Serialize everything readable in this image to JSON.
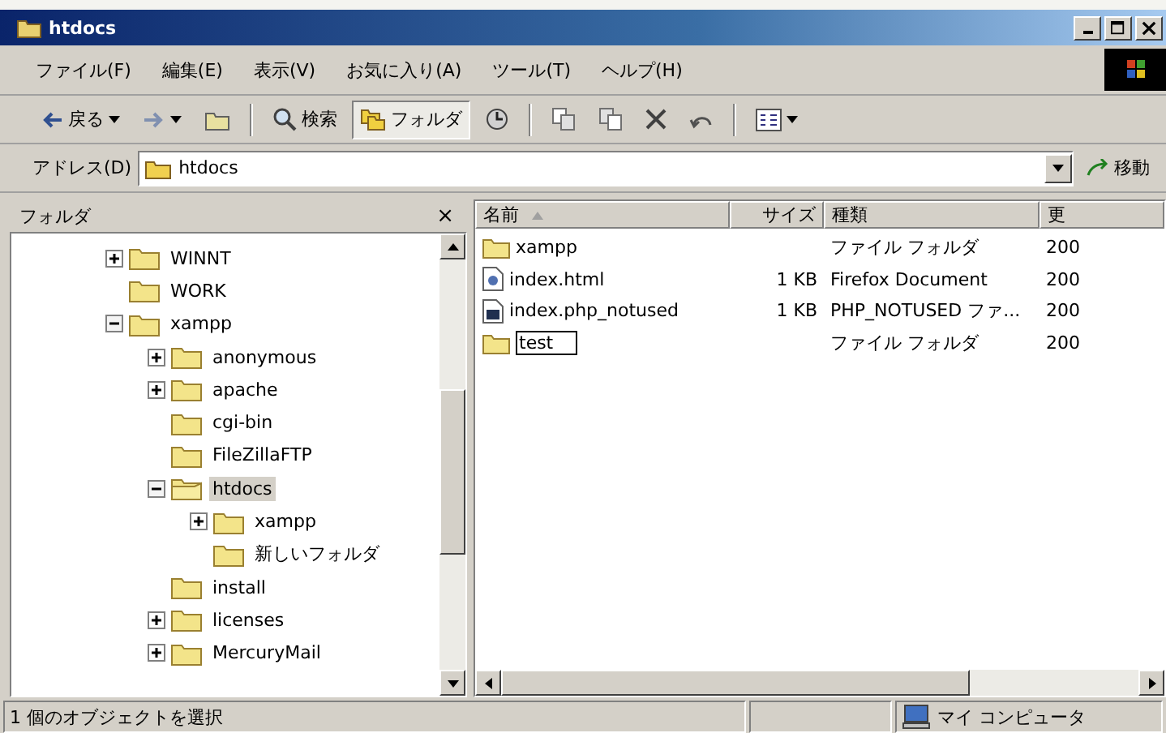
{
  "window": {
    "title": "htdocs"
  },
  "menu": [
    "ファイル(F)",
    "編集(E)",
    "表示(V)",
    "お気に入り(A)",
    "ツール(T)",
    "ヘルプ(H)"
  ],
  "toolbar": [
    {
      "kind": "back",
      "label": "戻る",
      "selected": false
    },
    {
      "kind": "forward",
      "selected": false
    },
    {
      "kind": "up",
      "selected": false
    },
    {
      "kind": "search",
      "label": "検索",
      "selected": false
    },
    {
      "kind": "folders",
      "label": "フォルダ",
      "selected": true
    },
    {
      "kind": "history",
      "selected": false
    },
    {
      "kind": "move",
      "selected": false
    },
    {
      "kind": "copy",
      "selected": false
    },
    {
      "kind": "delete",
      "selected": false
    },
    {
      "kind": "undo",
      "selected": false
    },
    {
      "kind": "views",
      "selected": false
    }
  ],
  "address": {
    "label": "アドレス(D)",
    "value": "htdocs",
    "go": "移動"
  },
  "folder_pane": {
    "title": "フォルダ",
    "close": "×"
  },
  "tree": [
    {
      "name": "WINNT",
      "kind": "branch",
      "expanded": false,
      "selected": false
    },
    {
      "name": "WORK",
      "kind": "leaf",
      "selected": false
    },
    {
      "name": "xampp",
      "kind": "branch",
      "expanded": true,
      "selected": false,
      "children": [
        {
          "name": "anonymous",
          "kind": "branch",
          "expanded": false,
          "selected": false
        },
        {
          "name": "apache",
          "kind": "branch",
          "expanded": false,
          "selected": false
        },
        {
          "name": "cgi-bin",
          "kind": "leaf",
          "selected": false
        },
        {
          "name": "FileZillaFTP",
          "kind": "leaf",
          "selected": false
        },
        {
          "name": "htdocs",
          "kind": "branch",
          "expanded": true,
          "selected": true,
          "children": [
            {
              "name": "xampp",
              "kind": "branch",
              "expanded": false,
              "selected": false
            },
            {
              "name": "新しいフォルダ",
              "kind": "leaf",
              "selected": false
            }
          ]
        },
        {
          "name": "install",
          "kind": "leaf",
          "selected": false
        },
        {
          "name": "licenses",
          "kind": "branch",
          "expanded": false,
          "selected": false
        },
        {
          "name": "MercuryMail",
          "kind": "branch",
          "expanded": false,
          "selected": false
        }
      ]
    }
  ],
  "columns": [
    "名前",
    "サイズ",
    "種類",
    "更"
  ],
  "files": [
    {
      "kind": "folder",
      "name": "xampp",
      "type": "ファイル フォルダ",
      "modified": "200",
      "editing": false
    },
    {
      "kind": "html",
      "name": "index.html",
      "size": "1 KB",
      "type": "Firefox Document",
      "modified": "200",
      "editing": false
    },
    {
      "kind": "file",
      "name": "index.php_notused",
      "size": "1 KB",
      "type": "PHP_NOTUSED ファ...",
      "modified": "200",
      "editing": false
    },
    {
      "kind": "folder",
      "name": "test",
      "type": "ファイル フォルダ",
      "modified": "200",
      "editing": true
    }
  ],
  "status_bar": {
    "message": "1 個のオブジェクトを選択",
    "zone": "マイ コンピュータ"
  }
}
